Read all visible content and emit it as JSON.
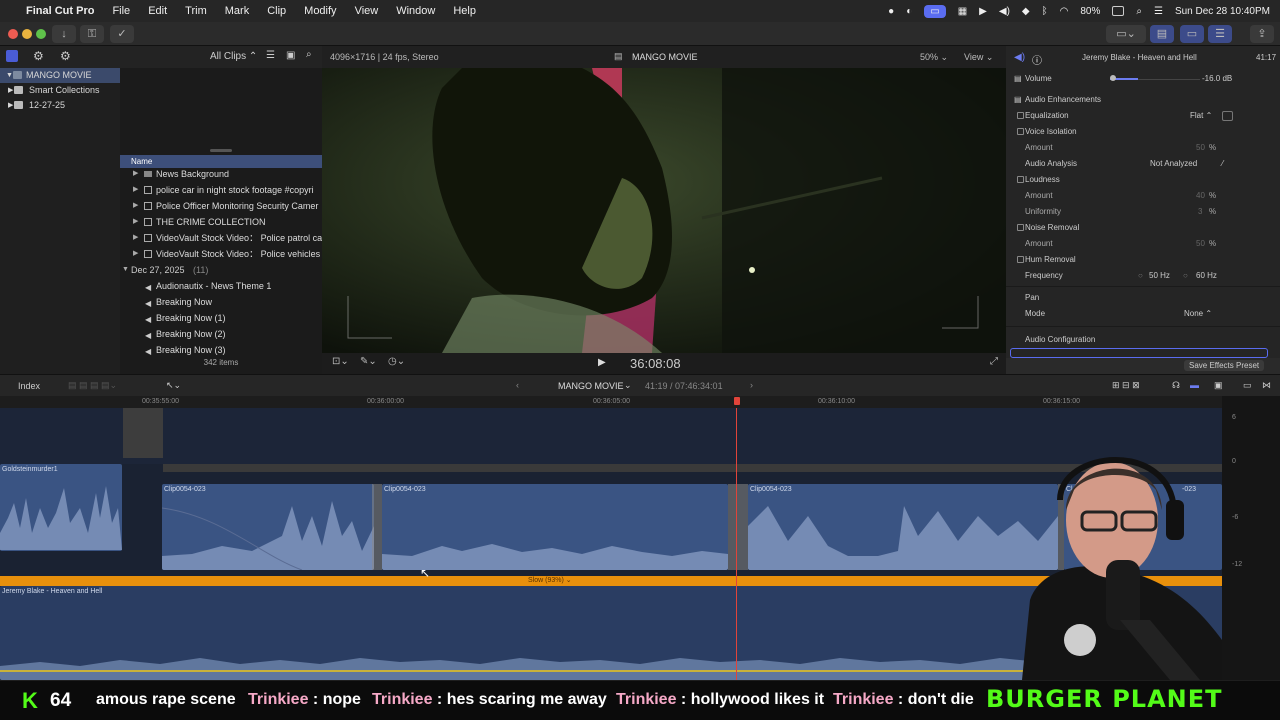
{
  "menubar": {
    "app_name": "Final Cut Pro",
    "items": [
      "File",
      "Edit",
      "Trim",
      "Mark",
      "Clip",
      "Modify",
      "View",
      "Window",
      "Help"
    ],
    "battery": "80%",
    "datetime": "Sun Dec 28  10:40PM"
  },
  "library": {
    "filter_label": "All Clips",
    "tree": [
      {
        "label": "MANGO MOVIE",
        "selected": true
      },
      {
        "label": "Smart Collections"
      },
      {
        "label": "12-27-25"
      }
    ],
    "column_header": "Name",
    "rows": [
      {
        "label": "News Background"
      },
      {
        "label": "police  car in night stock footage #copyri"
      },
      {
        "label": "Police Officer Monitoring Security Camer"
      },
      {
        "label": "THE CRIME COLLECTION"
      },
      {
        "label": "VideoVault Stock Video： Police patrol ca"
      },
      {
        "label": "VideoVault Stock Video： Police vehicles"
      }
    ],
    "group_label": "Dec 27, 2025",
    "group_count": "(11)",
    "audio_rows": [
      {
        "label": "Audionautix - News Theme 1"
      },
      {
        "label": "Breaking Now"
      },
      {
        "label": "Breaking Now (1)"
      },
      {
        "label": "Breaking Now (2)"
      },
      {
        "label": "Breaking Now (3)"
      }
    ],
    "item_count": "342 items"
  },
  "viewer": {
    "format": "4096×1716 | 24 fps, Stereo",
    "title": "MANGO MOVIE",
    "zoom": "50%",
    "view_label": "View",
    "timecode": "36:08:08"
  },
  "inspector": {
    "clip_name": "Jeremy Blake - Heaven and Hell",
    "duration": "41:17",
    "volume_label": "Volume",
    "volume_value": "-16.0  dB",
    "enhancements_label": "Audio Enhancements",
    "rows": [
      {
        "label": "Equalization",
        "value": "Flat",
        "checkbox": true
      },
      {
        "label": "Voice Isolation",
        "checkbox": true
      },
      {
        "label": "Amount",
        "value": "50",
        "unit": "%"
      },
      {
        "label": "Audio Analysis",
        "value": "Not Analyzed"
      },
      {
        "label": "Loudness",
        "checkbox": true
      },
      {
        "label": "Amount",
        "value": "40",
        "unit": "%"
      },
      {
        "label": "Uniformity",
        "value": "3",
        "unit": "%"
      },
      {
        "label": "Noise Removal",
        "checkbox": true
      },
      {
        "label": "Amount",
        "value": "50",
        "unit": "%"
      },
      {
        "label": "Hum Removal",
        "checkbox": true
      },
      {
        "label": "Frequency",
        "value": "50 Hz",
        "value2": "60 Hz"
      }
    ],
    "pan_label": "Pan",
    "mode_label": "Mode",
    "mode_value": "None",
    "audio_config_label": "Audio Configuration",
    "save_preset": "Save Effects Preset"
  },
  "timeline": {
    "index_label": "Index",
    "project": "MANGO MOVIE",
    "position": "41:19 / 07:46:34:01",
    "ruler": [
      "00:35:55:00",
      "00:36:00:00",
      "00:36:05:00",
      "00:36:10:00",
      "00:36:15:00"
    ],
    "clips": [
      {
        "name": "Goldsteinmurder1"
      },
      {
        "name": "Clip0054-023"
      },
      {
        "name": "Clip0054-023"
      },
      {
        "name": "Clip0054-023"
      },
      {
        "name": "Cl"
      },
      {
        "name": "-023"
      }
    ],
    "retime_label": "Slow (93%)",
    "music_clip": "Jeremy Blake - Heaven and Hell",
    "meter_labels": [
      "6",
      "0",
      "-6",
      "-12"
    ]
  },
  "ticker": {
    "kick_count": "64",
    "messages": [
      {
        "user": "",
        "text": "amous rape scene"
      },
      {
        "user": "Trinkiee",
        "text": " : nope"
      },
      {
        "user": "Trinkiee",
        "text": " : hes scaring me away"
      },
      {
        "user": "Trinkiee",
        "text": " : hollywood likes it"
      },
      {
        "user": "Trinkiee",
        "text": " : don't die"
      }
    ],
    "sponsor": "BURGER PLANET"
  },
  "colors": {
    "accent": "#5a6cf0",
    "playhead": "#e0443a",
    "retime_bar": "#e8900c",
    "clip_blue": "#3a5483",
    "selection": "#3d4f7a",
    "kick_green": "#53fc18"
  }
}
